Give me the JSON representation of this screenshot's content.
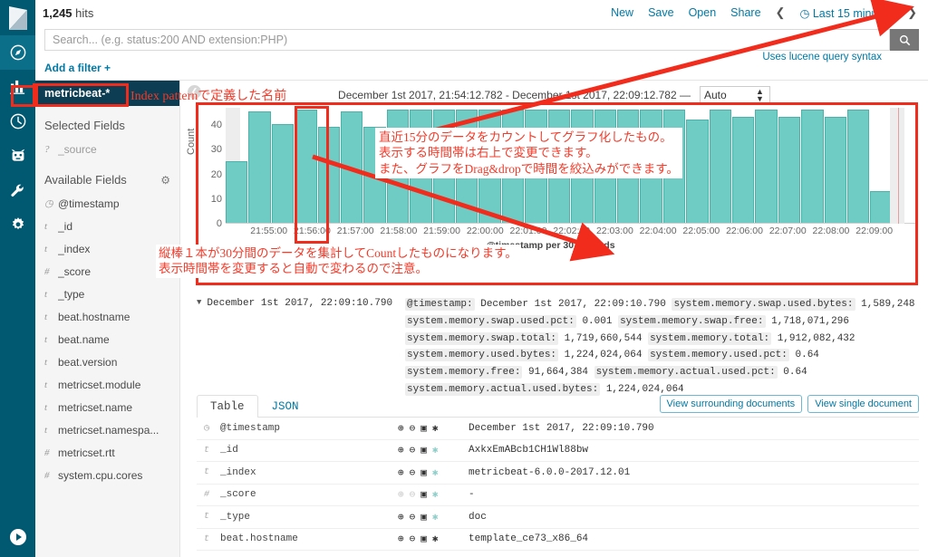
{
  "header": {
    "hits_count": "1,245",
    "hits_label": "hits",
    "nav": [
      "New",
      "Save",
      "Open",
      "Share"
    ],
    "prev_icon": "chevron-left-icon",
    "next_icon": "chevron-right-icon",
    "time_picker": "Last 15 minutes",
    "clock_icon": "clock-icon"
  },
  "search": {
    "placeholder": "Search... (e.g. status:200 AND extension:PHP)",
    "value": "",
    "lucene_hint": "Uses lucene query syntax",
    "search_icon": "search-icon"
  },
  "filters": {
    "add_filter": "Add a filter +"
  },
  "rail": {
    "logo": "kibana-logo",
    "items": [
      {
        "name": "discover",
        "icon": "compass-icon",
        "active": true
      },
      {
        "name": "visualize",
        "icon": "bar-chart-icon",
        "active": false
      },
      {
        "name": "dashboard",
        "icon": "dashboard-icon",
        "active": false
      },
      {
        "name": "timelion",
        "icon": "timelion-icon",
        "active": false
      },
      {
        "name": "dev-tools",
        "icon": "wrench-icon",
        "active": false
      },
      {
        "name": "management",
        "icon": "gear-icon",
        "active": false
      }
    ],
    "bottom": {
      "name": "collapse",
      "icon": "play-circle-icon"
    }
  },
  "sidebar": {
    "index_pattern": "metricbeat-*",
    "selected_fields_title": "Selected Fields",
    "selected_fields": [
      {
        "type": "?",
        "name": "_source",
        "muted": true
      }
    ],
    "available_fields_title": "Available Fields",
    "settings_icon": "gear-icon",
    "available_fields": [
      {
        "type": "◷",
        "name": "@timestamp"
      },
      {
        "type": "t",
        "name": "_id"
      },
      {
        "type": "t",
        "name": "_index"
      },
      {
        "type": "#",
        "name": "_score"
      },
      {
        "type": "t",
        "name": "_type"
      },
      {
        "type": "t",
        "name": "beat.hostname"
      },
      {
        "type": "t",
        "name": "beat.name"
      },
      {
        "type": "t",
        "name": "beat.version"
      },
      {
        "type": "t",
        "name": "metricset.module"
      },
      {
        "type": "t",
        "name": "metricset.name"
      },
      {
        "type": "t",
        "name": "metricset.namespa..."
      },
      {
        "type": "#",
        "name": "metricset.rtt"
      },
      {
        "type": "#",
        "name": "system.cpu.cores"
      }
    ]
  },
  "chart_header": {
    "collapse_icon": "chevron-left-circle-icon",
    "range": "December 1st 2017, 21:54:12.782 - December 1st 2017, 22:09:12.782 —",
    "interval": "Auto",
    "interval_icon": "updown-arrows-icon"
  },
  "chart_data": {
    "type": "bar",
    "title": "",
    "xlabel": "@timestamp per 30 seconds",
    "ylabel": "Count",
    "ylim": [
      0,
      47
    ],
    "yticks": [
      0,
      10,
      20,
      30,
      40
    ],
    "grid": false,
    "legend": "none",
    "x_tick_labels": [
      "21:55:00",
      "21:56:00",
      "21:57:00",
      "21:58:00",
      "21:59:00",
      "22:00:00",
      "22:01:00",
      "22:02:00",
      "22:03:00",
      "22:04:00",
      "22:05:00",
      "22:06:00",
      "22:07:00",
      "22:08:00",
      "22:09:00"
    ],
    "categories": [
      "21:54:30",
      "21:55:00",
      "21:55:30",
      "21:56:00",
      "21:56:30",
      "21:57:00",
      "21:57:30",
      "21:58:00",
      "21:58:30",
      "21:59:00",
      "21:59:30",
      "22:00:00",
      "22:00:30",
      "22:01:00",
      "22:01:30",
      "22:02:00",
      "22:02:30",
      "22:03:00",
      "22:03:30",
      "22:04:00",
      "22:04:30",
      "22:05:00",
      "22:05:30",
      "22:06:00",
      "22:06:30",
      "22:07:00",
      "22:07:30",
      "22:08:00",
      "22:08:30",
      "22:09:00"
    ],
    "values": [
      25,
      45,
      40,
      46,
      39,
      45,
      39,
      46,
      46,
      46,
      46,
      46,
      46,
      46,
      46,
      46,
      46,
      46,
      46,
      46,
      42,
      46,
      43,
      46,
      43,
      46,
      43,
      46,
      13,
      0
    ],
    "bar_color": "#6eccc4",
    "bar_border_color": "#4cb3aa"
  },
  "doc_preview": {
    "caret_icon": "caret-down-icon",
    "time": "December 1st 2017, 22:09:10.790",
    "fields": [
      {
        "key": "@timestamp:",
        "value": "December 1st 2017, 22:09:10.790"
      },
      {
        "key": "system.memory.swap.used.bytes:",
        "value": "1,589,248"
      },
      {
        "key": "system.memory.swap.used.pct:",
        "value": "0.001"
      },
      {
        "key": "system.memory.swap.free:",
        "value": "1,718,071,296"
      },
      {
        "key": "system.memory.swap.total:",
        "value": "1,719,660,544"
      },
      {
        "key": "system.memory.total:",
        "value": "1,912,082,432"
      },
      {
        "key": "system.memory.used.bytes:",
        "value": "1,224,024,064"
      },
      {
        "key": "system.memory.used.pct:",
        "value": "0.64"
      },
      {
        "key": "system.memory.free:",
        "value": "91,664,384"
      },
      {
        "key": "system.memory.actual.used.pct:",
        "value": "0.64"
      },
      {
        "key": "system.memory.actual.used.bytes:",
        "value": "1,224,024,064"
      }
    ]
  },
  "tabs": {
    "items": [
      {
        "label": "Table",
        "active": true
      },
      {
        "label": "JSON",
        "active": false
      }
    ],
    "buttons": [
      "View surrounding documents",
      "View single document"
    ]
  },
  "detail_table": {
    "action_icons": [
      "filter-for-value-icon",
      "filter-out-value-icon",
      "toggle-column-icon",
      "filter-for-field-present-icon"
    ],
    "rows": [
      {
        "type": "◷",
        "field": "@timestamp",
        "value": "December 1st 2017, 22:09:10.790",
        "dim": false,
        "star_on": true
      },
      {
        "type": "t",
        "field": "_id",
        "value": "AxkxEmABcb1CH1Wl88bw",
        "dim": false,
        "star_on": false
      },
      {
        "type": "t",
        "field": "_index",
        "value": "metricbeat-6.0.0-2017.12.01",
        "dim": false,
        "star_on": false
      },
      {
        "type": "#",
        "field": "_score",
        "value": "-",
        "dim": true,
        "star_on": false
      },
      {
        "type": "t",
        "field": "_type",
        "value": "doc",
        "dim": false,
        "star_on": false
      },
      {
        "type": "t",
        "field": "beat.hostname",
        "value": "template_ce73_x86_64",
        "dim": false,
        "star_on": true
      }
    ]
  },
  "annotations": {
    "index_pattern_note": "Index patternで定義した名前",
    "chart_note_lines": [
      "直近15分のデータをカウントしてグラフ化したもの。",
      "表示する時間帯は右上で変更できます。",
      "また、グラフをDrag&dropで時間を絞込みができます。"
    ],
    "bar_note_lines": [
      "縦棒１本が30分間のデータを集計してCountしたものになります。",
      "表示時間帯を変更すると自動で変わるので注意。"
    ],
    "accent_color": "#f43b2a"
  }
}
